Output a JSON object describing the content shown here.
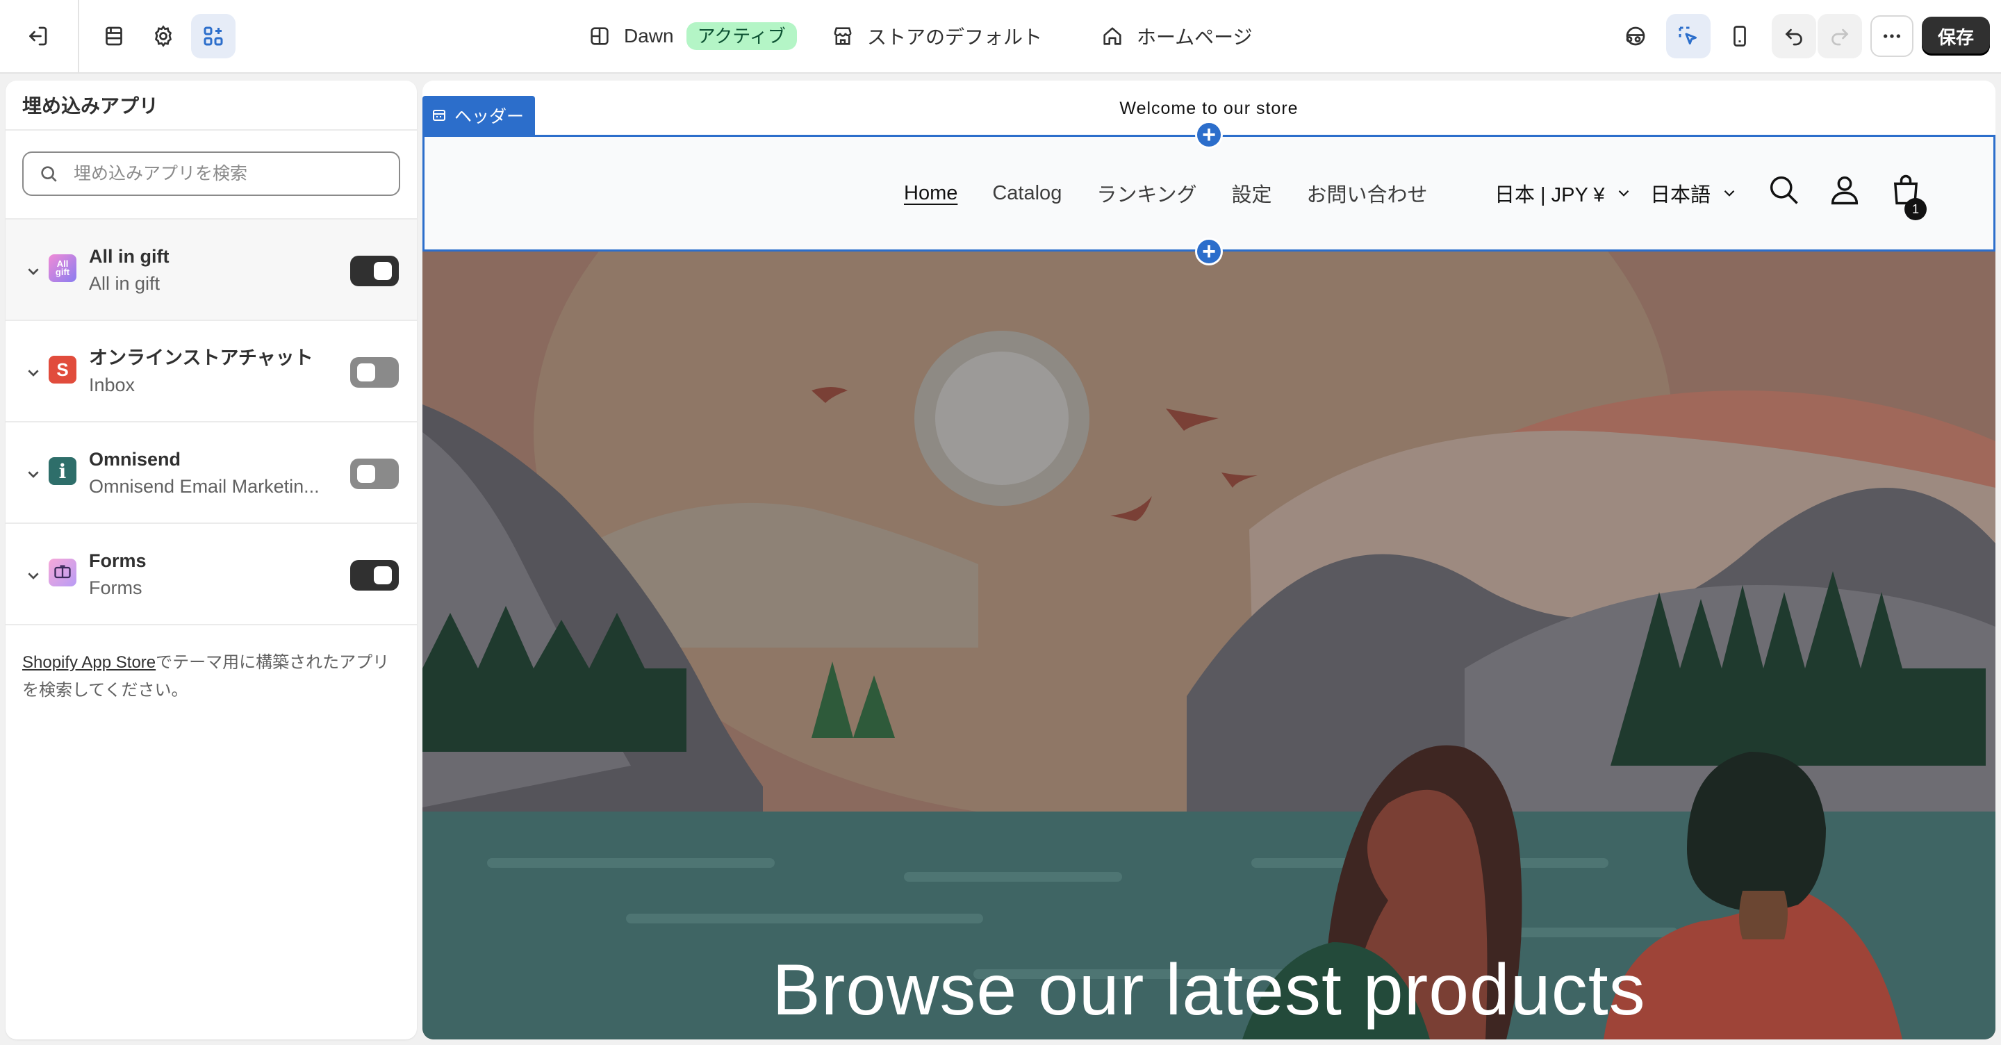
{
  "topbar": {
    "theme_name": "Dawn",
    "theme_status": "アクティブ",
    "store_default": "ストアのデフォルト",
    "page": "ホームページ",
    "save_label": "保存",
    "icons": [
      "exit-icon",
      "sections-icon",
      "settings-icon",
      "apps-icon",
      "theme-layout-icon",
      "store-icon",
      "home-icon",
      "inspector-icon",
      "select-icon",
      "mobile-icon",
      "undo-icon",
      "redo-icon",
      "more-icon"
    ]
  },
  "sidebar": {
    "title": "埋め込みアプリ",
    "search_placeholder": "埋め込みアプリを検索",
    "apps": [
      {
        "name": "All in gift",
        "subtitle": "All in gift",
        "enabled": true,
        "icon": "all-in-gift-icon"
      },
      {
        "name": "オンラインストアチャット",
        "subtitle": "Inbox",
        "enabled": false,
        "icon": "inbox-icon"
      },
      {
        "name": "Omnisend",
        "subtitle": "Omnisend Email Marketin...",
        "enabled": false,
        "icon": "omnisend-icon"
      },
      {
        "name": "Forms",
        "subtitle": "Forms",
        "enabled": true,
        "icon": "forms-icon"
      }
    ],
    "footer_link": "Shopify App Store",
    "footer_text": "でテーマ用に構築されたアプリを検索してください。"
  },
  "preview": {
    "announcement": "Welcome to our store",
    "section_tag": "ヘッダー",
    "nav": [
      "Home",
      "Catalog",
      "ランキング",
      "設定",
      "お問い合わせ"
    ],
    "currency": "日本 | JPY ¥",
    "language": "日本語",
    "cart_count": "1",
    "hero_title": "Browse our latest products"
  },
  "colors": {
    "accent": "#2c6ecb",
    "active_badge_bg": "#b4f5c6",
    "save_bg": "#303030"
  }
}
